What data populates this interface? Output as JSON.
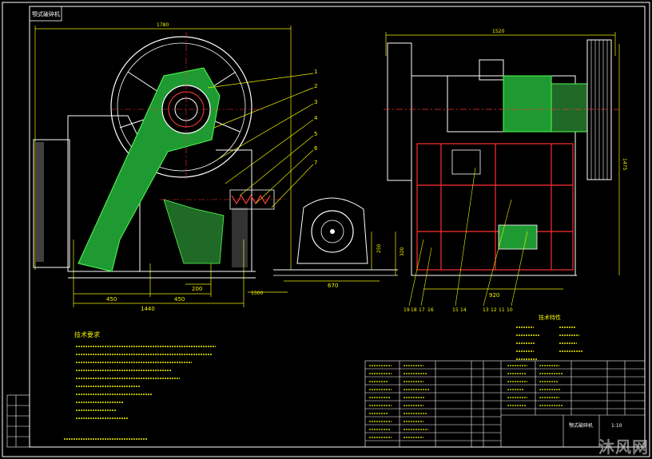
{
  "title_tag": "颚式破碎机",
  "dimensions": {
    "front_width_top": "1780",
    "front_width_bottom": "1440",
    "front_a": "450",
    "front_b": "450",
    "front_c": "200",
    "front_d": "1500",
    "motor_width": "670",
    "motor_h1": "250",
    "motor_h2": "320",
    "side_width_top": "1520",
    "side_width_bottom": "920",
    "side_height": "1475"
  },
  "part_callouts_front": [
    "1",
    "2",
    "3",
    "4",
    "5",
    "6",
    "7"
  ],
  "part_callouts_side": [
    "19",
    "18",
    "17",
    "16",
    "15",
    "14",
    "13",
    "12",
    "11",
    "10"
  ],
  "notes": {
    "heading": "技术要求",
    "lines": [
      "",
      "",
      "",
      "",
      "",
      "",
      "",
      "",
      "",
      ""
    ]
  },
  "spec_heading": "技术特性",
  "title_block": {
    "name": "颚式破碎机",
    "scale": "1:10"
  },
  "watermark": "沐风网"
}
